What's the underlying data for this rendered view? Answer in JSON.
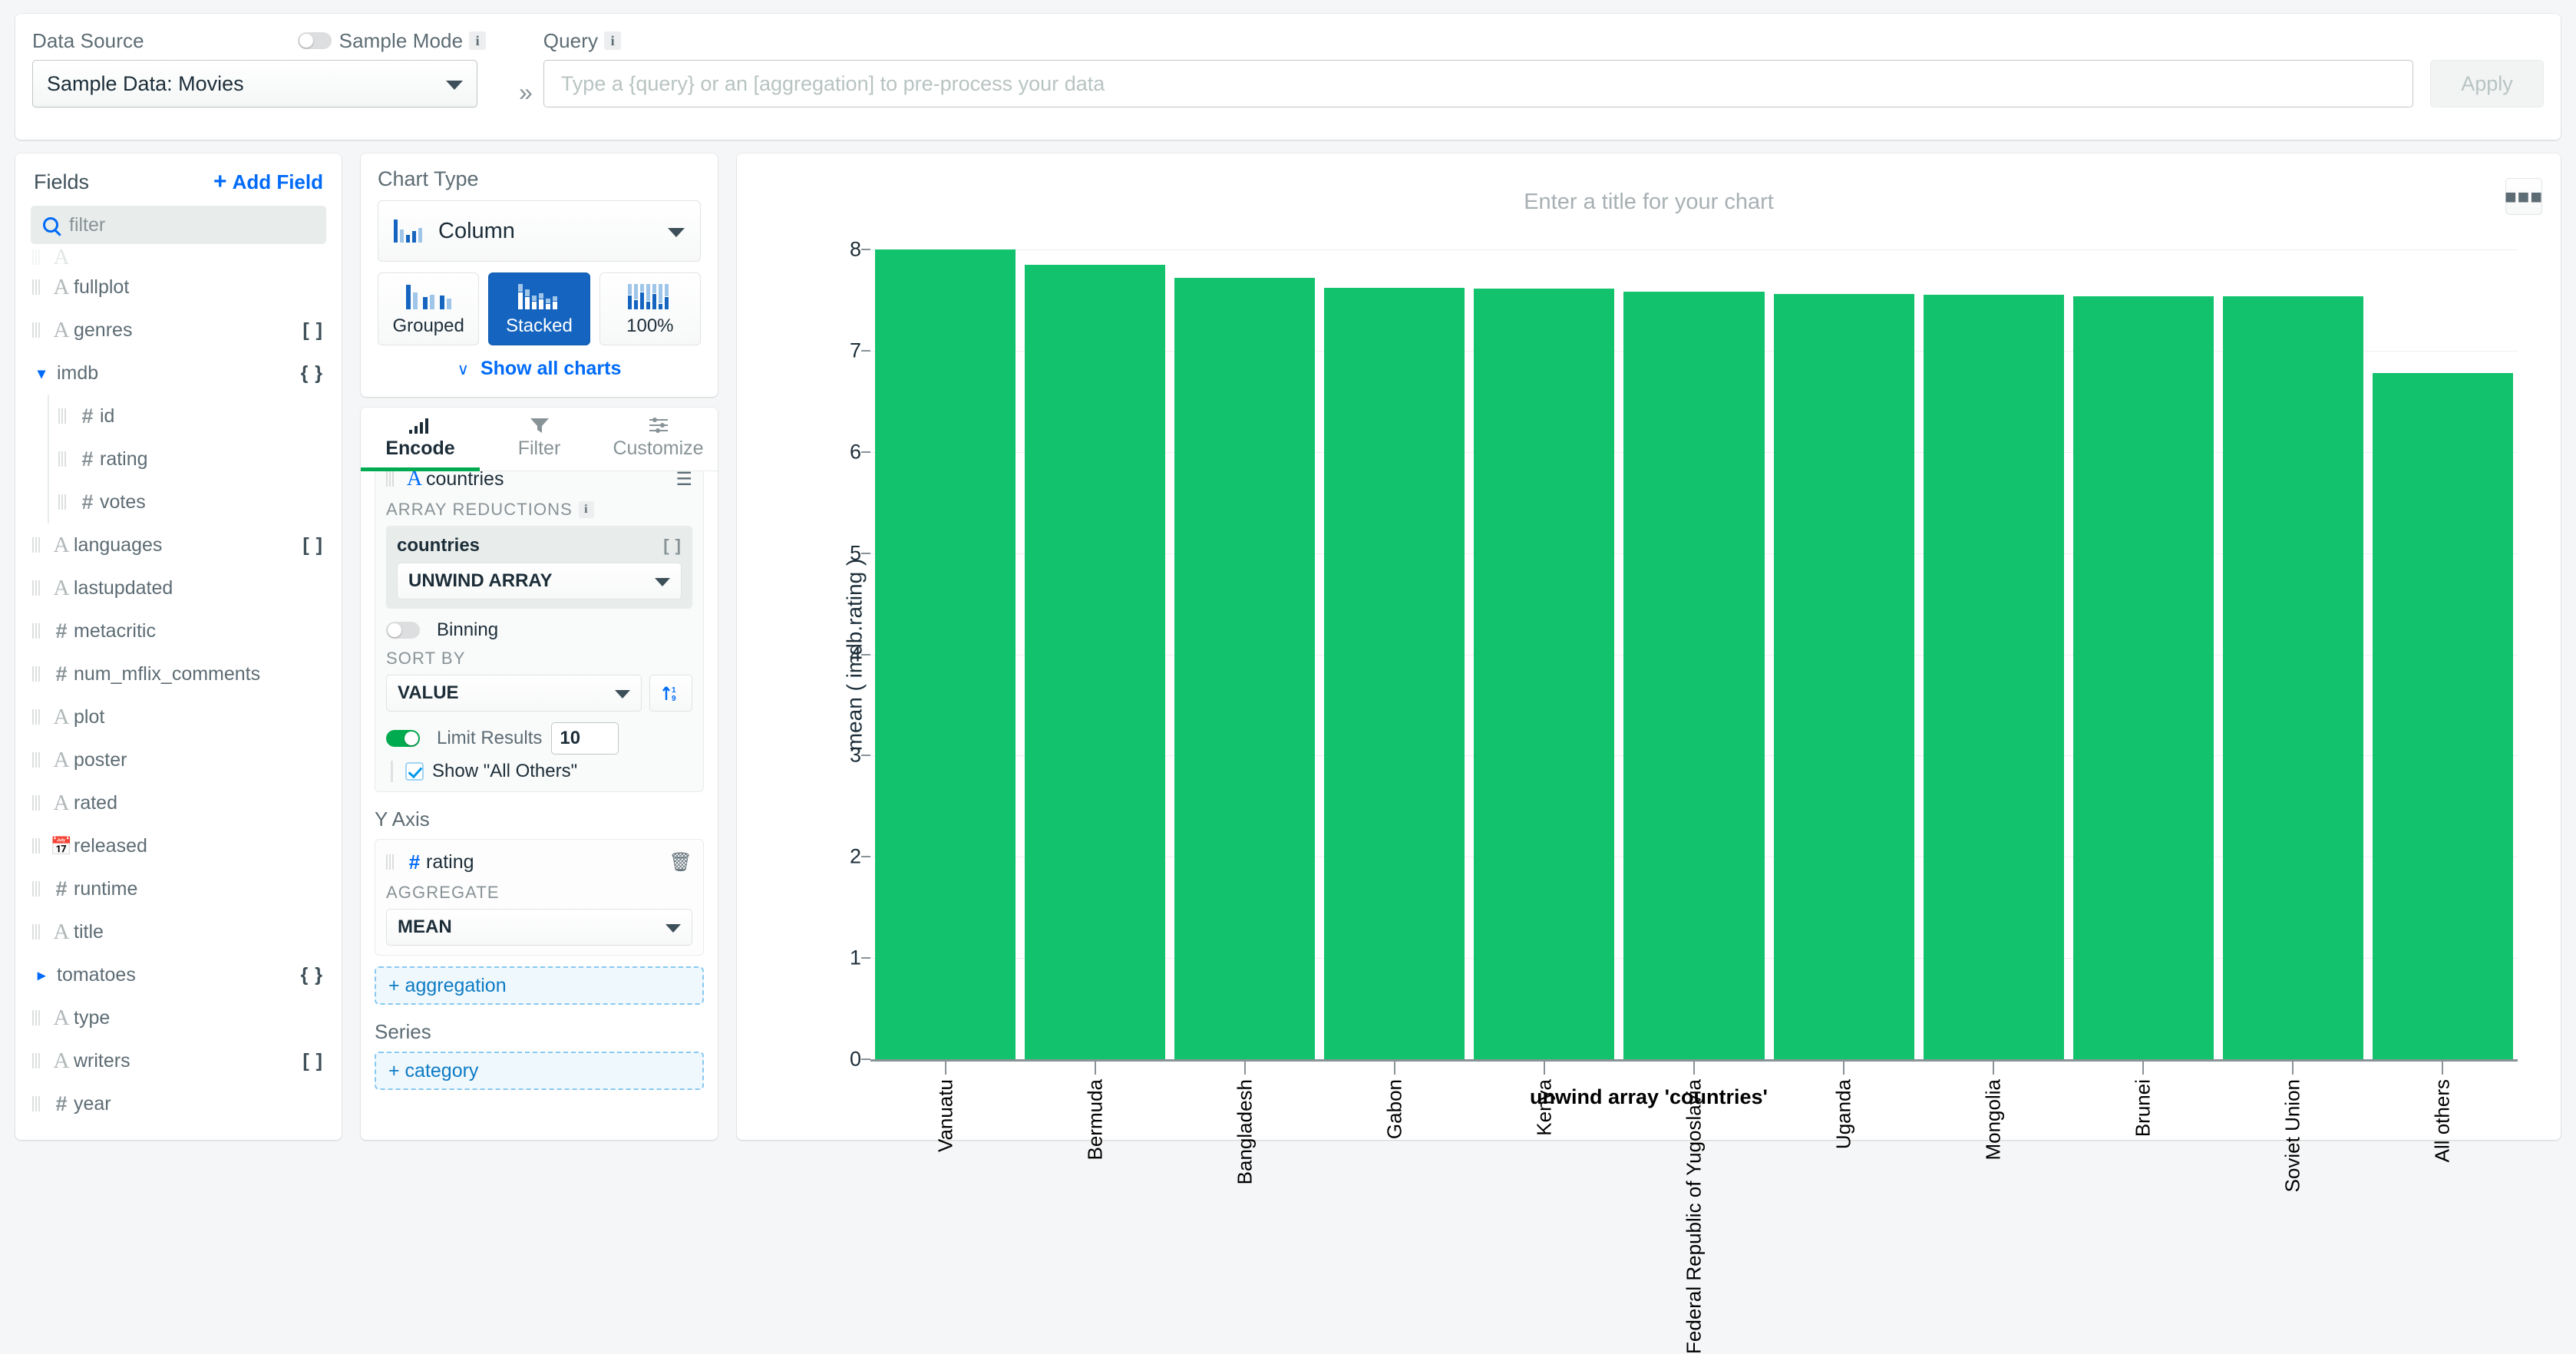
{
  "topbar": {
    "data_source_label": "Data Source",
    "sample_mode_label": "Sample Mode",
    "sample_mode_on": false,
    "data_source_value": "Sample Data: Movies",
    "chevron_separator": "»",
    "query_label": "Query",
    "query_placeholder": "Type a {query} or an [aggregation] to pre-process your data",
    "query_value": "",
    "apply_label": "Apply",
    "info_glyph": "i"
  },
  "fields": {
    "title": "Fields",
    "add_field_label": "Add Field",
    "add_field_plus": "+",
    "filter_placeholder": "filter",
    "items": [
      {
        "name": "",
        "icon": "string-icon",
        "type": "",
        "indent": 0,
        "clipped": true
      },
      {
        "name": "fullplot",
        "icon": "string-icon",
        "type": "",
        "indent": 0
      },
      {
        "name": "genres",
        "icon": "string-icon",
        "type": "[ ]",
        "indent": 0
      },
      {
        "name": "imdb",
        "icon": "expander-down-icon",
        "type": "{ }",
        "indent": 0,
        "expanded": true
      },
      {
        "name": "id",
        "icon": "number-icon",
        "type": "",
        "indent": 1
      },
      {
        "name": "rating",
        "icon": "number-icon",
        "type": "",
        "indent": 1
      },
      {
        "name": "votes",
        "icon": "number-icon",
        "type": "",
        "indent": 1
      },
      {
        "name": "languages",
        "icon": "string-icon",
        "type": "[ ]",
        "indent": 0
      },
      {
        "name": "lastupdated",
        "icon": "string-icon",
        "type": "",
        "indent": 0
      },
      {
        "name": "metacritic",
        "icon": "number-icon",
        "type": "",
        "indent": 0
      },
      {
        "name": "num_mflix_comments",
        "icon": "number-icon",
        "type": "",
        "indent": 0
      },
      {
        "name": "plot",
        "icon": "string-icon",
        "type": "",
        "indent": 0
      },
      {
        "name": "poster",
        "icon": "string-icon",
        "type": "",
        "indent": 0
      },
      {
        "name": "rated",
        "icon": "string-icon",
        "type": "",
        "indent": 0
      },
      {
        "name": "released",
        "icon": "calendar-icon",
        "type": "",
        "indent": 0
      },
      {
        "name": "runtime",
        "icon": "number-icon",
        "type": "",
        "indent": 0
      },
      {
        "name": "title",
        "icon": "string-icon",
        "type": "",
        "indent": 0
      },
      {
        "name": "tomatoes",
        "icon": "expander-right-icon",
        "type": "{ }",
        "indent": 0,
        "expanded": false
      },
      {
        "name": "type",
        "icon": "string-icon",
        "type": "",
        "indent": 0
      },
      {
        "name": "writers",
        "icon": "string-icon",
        "type": "[ ]",
        "indent": 0
      },
      {
        "name": "year",
        "icon": "number-icon",
        "type": "",
        "indent": 0
      }
    ]
  },
  "chart_type": {
    "title": "Chart Type",
    "selected": "Column",
    "variants": [
      {
        "label": "Grouped",
        "active": false
      },
      {
        "label": "Stacked",
        "active": true
      },
      {
        "label": "100%",
        "active": false
      }
    ],
    "show_all_label": "Show all charts",
    "show_all_chevron": "∨"
  },
  "encode": {
    "tabs": [
      {
        "label": "Encode",
        "active": true,
        "icon": "bar-chart-icon"
      },
      {
        "label": "Filter",
        "active": false,
        "icon": "funnel-icon"
      },
      {
        "label": "Customize",
        "active": false,
        "icon": "sliders-icon"
      }
    ],
    "x_axis": {
      "field_name": "countries",
      "array_reductions_label": "ARRAY REDUCTIONS",
      "reduction_field": "countries",
      "reduction_type_badge": "[ ]",
      "reduction_value": "UNWIND ARRAY",
      "binning_label": "Binning",
      "binning_on": false,
      "sort_by_label": "SORT BY",
      "sort_by_value": "VALUE",
      "sort_dir_icon": "sort-ascending-icon",
      "limit_results_label": "Limit Results",
      "limit_results_on": true,
      "limit_value": "10",
      "show_all_others_label": "Show \"All Others\"",
      "show_all_others_checked": true
    },
    "y_axis": {
      "section_title": "Y Axis",
      "field_name": "rating",
      "aggregate_label": "AGGREGATE",
      "aggregate_value": "MEAN",
      "add_aggregation_label": "+ aggregation",
      "delete_icon": "trash-icon"
    },
    "series": {
      "section_title": "Series",
      "add_category_label": "+ category"
    }
  },
  "chart": {
    "title_placeholder": "Enter a title for your chart",
    "menu_icon": "ellipsis-icon"
  },
  "colors": {
    "bar": "#13c26c",
    "accent_blue": "#016bf8",
    "accent_green": "#00ab4f",
    "stacked_active": "#1565c0"
  },
  "chart_data": {
    "type": "bar",
    "title": "",
    "xlabel": "unwind array 'countries'",
    "ylabel": "mean ( imdb.rating )",
    "ylim": [
      0,
      8
    ],
    "yticks": [
      0,
      1,
      2,
      3,
      4,
      5,
      6,
      7,
      8
    ],
    "grid": true,
    "legend": "none",
    "categories": [
      "Vanuatu",
      "Bermuda",
      "Bangladesh",
      "Gabon",
      "Kenya",
      "Federal Republic of Yugoslavia",
      "Uganda",
      "Mongolia",
      "Brunei",
      "Soviet Union",
      "All others"
    ],
    "values": [
      8.0,
      7.85,
      7.72,
      7.62,
      7.61,
      7.58,
      7.56,
      7.55,
      7.54,
      7.54,
      6.78
    ]
  }
}
